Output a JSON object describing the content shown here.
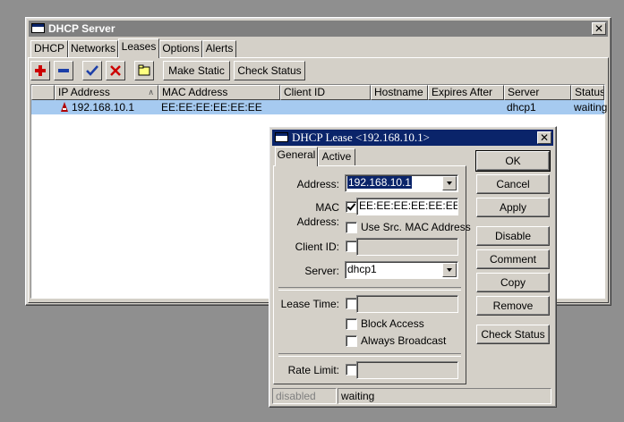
{
  "main_window": {
    "title": "DHCP Server",
    "close_glyph": "✕",
    "tabs": [
      {
        "label": "DHCP"
      },
      {
        "label": "Networks"
      },
      {
        "label": "Leases"
      },
      {
        "label": "Options"
      },
      {
        "label": "Alerts"
      }
    ],
    "toolbar": {
      "make_static_label": "Make Static",
      "check_status_label": "Check Status",
      "icons": [
        "add-icon",
        "remove-icon",
        "enable-icon",
        "disable-icon",
        "comment-icon"
      ]
    },
    "table": {
      "columns": [
        "IP Address",
        "MAC Address",
        "Client ID",
        "Hostname",
        "Expires After",
        "Server",
        "Status"
      ],
      "sort_indicator": "∧",
      "rows": [
        {
          "ip": "192.168.10.1",
          "mac": "EE:EE:EE:EE:EE:EE",
          "client_id": "",
          "hostname": "",
          "expires": "",
          "server": "dhcp1",
          "status": "waiting"
        }
      ]
    }
  },
  "lease_dialog": {
    "title": "DHCP Lease <192.168.10.1>",
    "close_glyph": "✕",
    "tabs": [
      {
        "label": "General"
      },
      {
        "label": "Active"
      }
    ],
    "fields": {
      "address_label": "Address:",
      "address_value": "192.168.10.1",
      "mac_label": "MAC Address:",
      "mac_value": "EE:EE:EE:EE:EE:EE",
      "use_src_mac_label": "Use Src. MAC Address",
      "client_id_label": "Client ID:",
      "server_label": "Server:",
      "server_value": "dhcp1",
      "lease_time_label": "Lease Time:",
      "block_access_label": "Block Access",
      "always_broadcast_label": "Always Broadcast",
      "rate_limit_label": "Rate Limit:"
    },
    "buttons": {
      "ok": "OK",
      "cancel": "Cancel",
      "apply": "Apply",
      "disable": "Disable",
      "comment": "Comment",
      "copy": "Copy",
      "remove": "Remove",
      "check_status": "Check Status"
    },
    "status_bar": {
      "left": "disabled",
      "right": "waiting"
    }
  },
  "colors": {
    "titlebar_active": "#0a246a",
    "titlebar_inactive": "#808080",
    "selection_row": "#a6caf0",
    "add_red": "#cc0000",
    "check_blue": "#1c3fa8"
  }
}
